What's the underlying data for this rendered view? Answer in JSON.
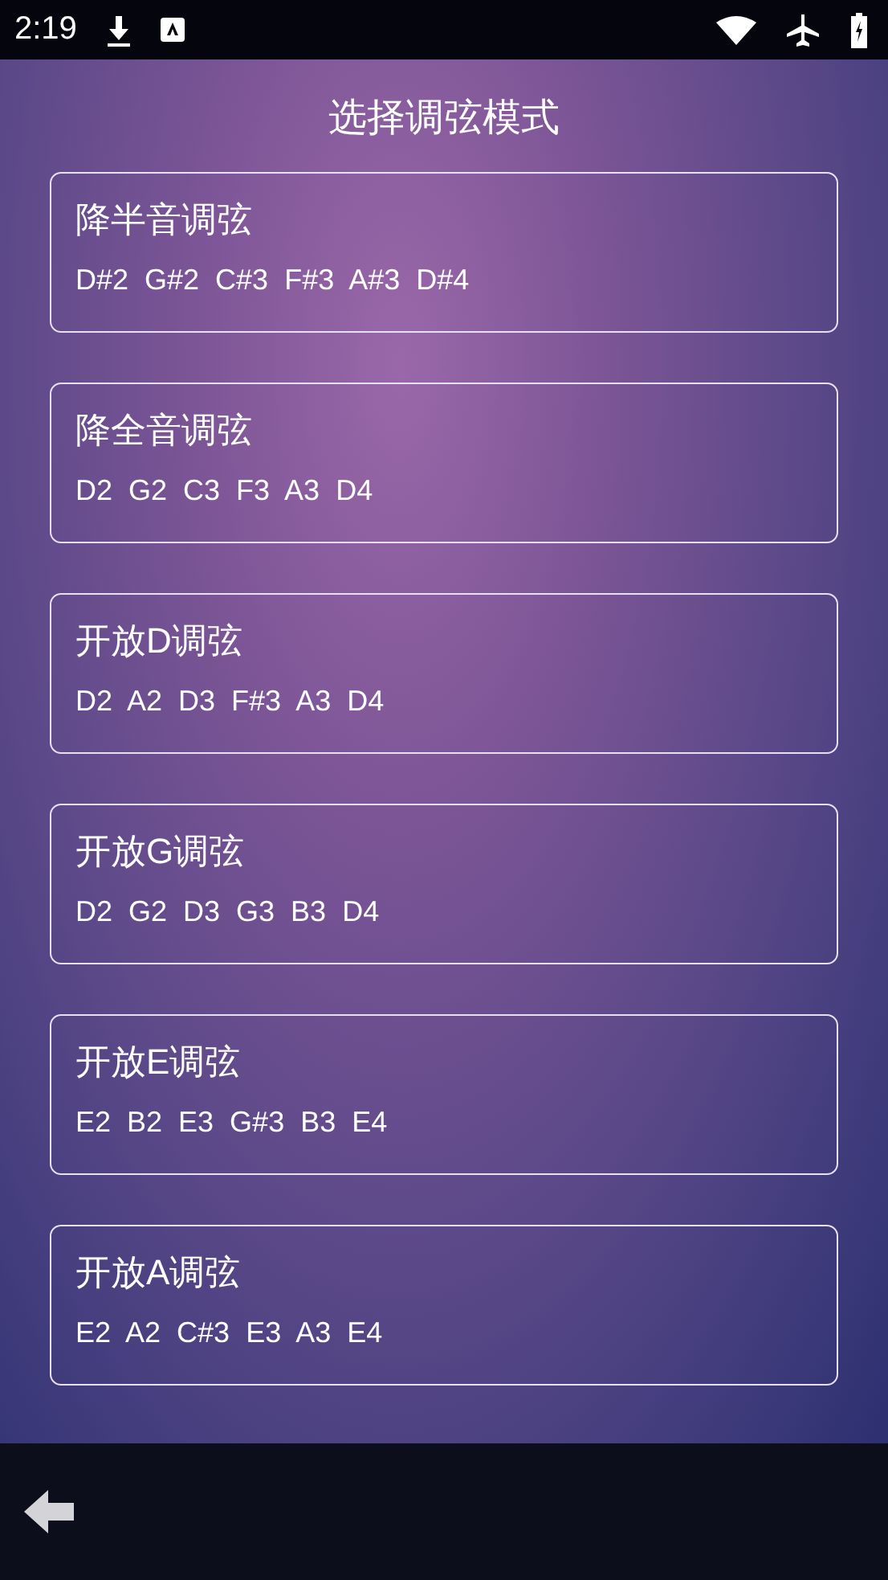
{
  "status_bar": {
    "time": "2:19"
  },
  "title": "选择调弦模式",
  "tunings": [
    {
      "name": "降半音调弦",
      "notes": "D#2  G#2  C#3  F#3  A#3  D#4"
    },
    {
      "name": "降全音调弦",
      "notes": "D2  G2  C3  F3  A3  D4"
    },
    {
      "name": "开放D调弦",
      "notes": "D2  A2  D3  F#3  A3  D4"
    },
    {
      "name": "开放G调弦",
      "notes": "D2  G2  D3  G3  B3  D4"
    },
    {
      "name": "开放E调弦",
      "notes": "E2  B2  E3  G#3  B3  E4"
    },
    {
      "name": "开放A调弦",
      "notes": "E2  A2  C#3  E3  A3  E4"
    }
  ]
}
